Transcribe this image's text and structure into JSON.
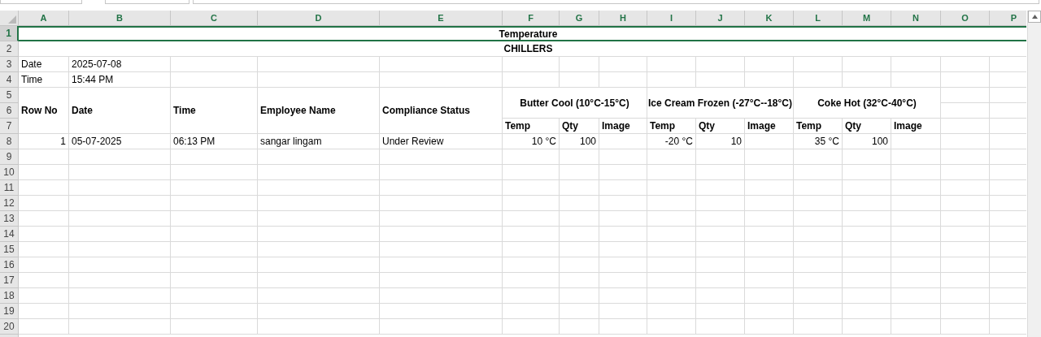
{
  "columns": [
    {
      "label": "A",
      "selected": true
    },
    {
      "label": "B",
      "selected": true
    },
    {
      "label": "C",
      "selected": true
    },
    {
      "label": "D",
      "selected": true
    },
    {
      "label": "E",
      "selected": true
    },
    {
      "label": "F",
      "selected": true
    },
    {
      "label": "G",
      "selected": true
    },
    {
      "label": "H",
      "selected": true
    },
    {
      "label": "I",
      "selected": true
    },
    {
      "label": "J",
      "selected": true
    },
    {
      "label": "K",
      "selected": true
    },
    {
      "label": "L",
      "selected": true
    },
    {
      "label": "M",
      "selected": true
    },
    {
      "label": "N",
      "selected": true
    },
    {
      "label": "O",
      "selected": true
    },
    {
      "label": "P",
      "selected": true
    }
  ],
  "row_numbers": [
    {
      "label": "1",
      "selected": true
    },
    {
      "label": "2",
      "selected": false
    },
    {
      "label": "3",
      "selected": false
    },
    {
      "label": "4",
      "selected": false
    },
    {
      "label": "5",
      "selected": false
    },
    {
      "label": "6",
      "selected": false
    },
    {
      "label": "7",
      "selected": false
    },
    {
      "label": "8",
      "selected": false
    },
    {
      "label": "9",
      "selected": false
    },
    {
      "label": "10",
      "selected": false
    },
    {
      "label": "11",
      "selected": false
    },
    {
      "label": "12",
      "selected": false
    },
    {
      "label": "13",
      "selected": false
    },
    {
      "label": "14",
      "selected": false
    },
    {
      "label": "15",
      "selected": false
    },
    {
      "label": "16",
      "selected": false
    },
    {
      "label": "17",
      "selected": false
    },
    {
      "label": "18",
      "selected": false
    },
    {
      "label": "19",
      "selected": false
    },
    {
      "label": "20",
      "selected": false
    }
  ],
  "titles": [
    {
      "text": "Temperature",
      "selected": true
    },
    {
      "text": "CHILLERS",
      "selected": false
    }
  ],
  "info": [
    {
      "label": "Date",
      "value": "2025-07-08"
    },
    {
      "label": "Time",
      "value": "15:44 PM"
    }
  ],
  "headers": [
    "Row No",
    "Date",
    "Time",
    "Employee Name",
    "Compliance Status"
  ],
  "groups": [
    {
      "title": "Butter  Cool (10°C-15°C)",
      "subheads": [
        "Temp",
        "Qty",
        "Image"
      ]
    },
    {
      "title": "Ice Cream  Frozen (-27°C--18°C)",
      "subheads": [
        "Temp",
        "Qty",
        "Image"
      ]
    },
    {
      "title": "Coke Hot (32°C-40°C)",
      "subheads": [
        "Temp",
        "Qty",
        "Image"
      ]
    }
  ],
  "records": [
    {
      "row_no": "1",
      "date": "05-07-2025",
      "time": "06:13 PM",
      "employee": "sangar lingam",
      "status": "Under Review",
      "readings": [
        {
          "temp": "10 °C",
          "qty": "100"
        },
        {
          "temp": "-20 °C",
          "qty": "10"
        },
        {
          "temp": "35 °C",
          "qty": "100"
        }
      ]
    }
  ]
}
